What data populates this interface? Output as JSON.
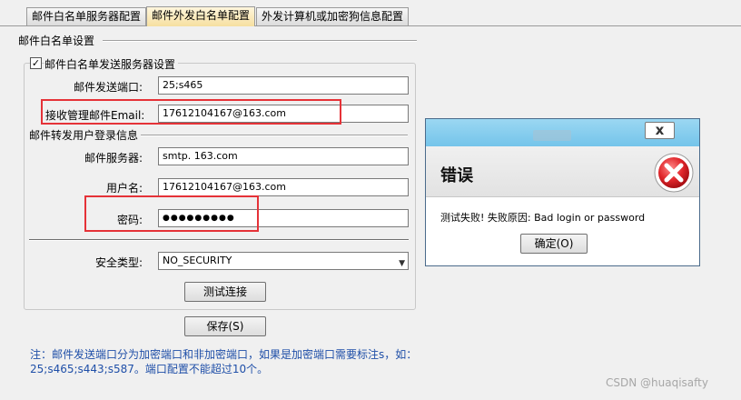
{
  "tabs": [
    {
      "label": "邮件白名单服务器配置"
    },
    {
      "label": "邮件外发白名单配置"
    },
    {
      "label": "外发计算机或加密狗信息配置"
    }
  ],
  "section": {
    "title": "邮件白名单设置"
  },
  "server_group": {
    "checkbox_checked": true,
    "checkbox_mark": "✓",
    "checkbox_label": "邮件白名单发送服务器设置",
    "port_label": "邮件发送端口:",
    "port_value": "25;s465",
    "receiver_label": "接收管理邮件Email:",
    "receiver_value": "17612104167@163.com",
    "login_section": "邮件转发用户登录信息",
    "server_label": "邮件服务器:",
    "server_value": "smtp. 163.com",
    "username_label": "用户名:",
    "username_value": "17612104167@163.com",
    "password_label": "密码:",
    "password_value": "●●●●●●●●●",
    "security_label": "安全类型:",
    "security_value": "NO_SECURITY",
    "test_button": "测试连接"
  },
  "save_button": "保存(S)",
  "note": "注：邮件发送端口分为加密端口和非加密端口，如果是加密端口需要标注s，如：25;s465;s443;s587。端口配置不能超过10个。",
  "dialog": {
    "heading": "错误",
    "message": "测试失败! 失败原因:  Bad login or password",
    "ok_button": "确定(O)",
    "close_glyph": "x",
    "icon": "error-icon"
  },
  "watermark": "CSDN @huaqisafty",
  "colors": {
    "highlight_box": "#e53238",
    "note_text": "#1f4fa8",
    "dialog_titlebar": "#87cdee",
    "error_icon": "#d8262b"
  }
}
